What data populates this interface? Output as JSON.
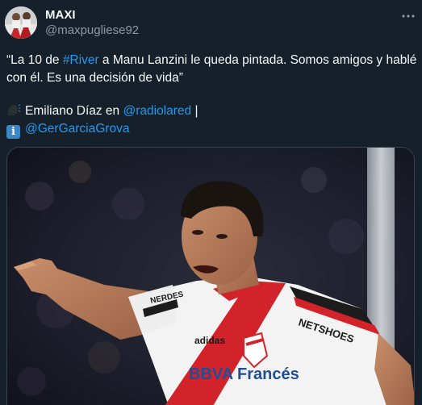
{
  "author": {
    "display_name": "MAXI",
    "handle": "@maxpugliese92"
  },
  "tweet": {
    "line1_pre": "“La 10 de ",
    "line1_hashtag": "#River",
    "line1_post": " a Manu Lanzini le queda pintada. Somos amigos y hablé",
    "line2": "con él. Es una decisión de vida”",
    "credit_pre": "Emiliano Díaz en ",
    "credit_mention": "@radiolared",
    "credit_post": " |",
    "source_mention": "@GerGarciaGrova"
  },
  "media": {
    "jersey_sponsor": "NETSHOES",
    "jersey_brand": "BBVA Francés",
    "jersey_sleeve": "NERDES"
  },
  "icons": {
    "more": "more-dots-icon",
    "speaker": "speaking-head-icon",
    "info": "info-icon"
  },
  "colors": {
    "background": "#15202b",
    "link": "#1d9bf0",
    "secondary_text": "#8b98a5",
    "jersey_red": "#d2232a"
  }
}
